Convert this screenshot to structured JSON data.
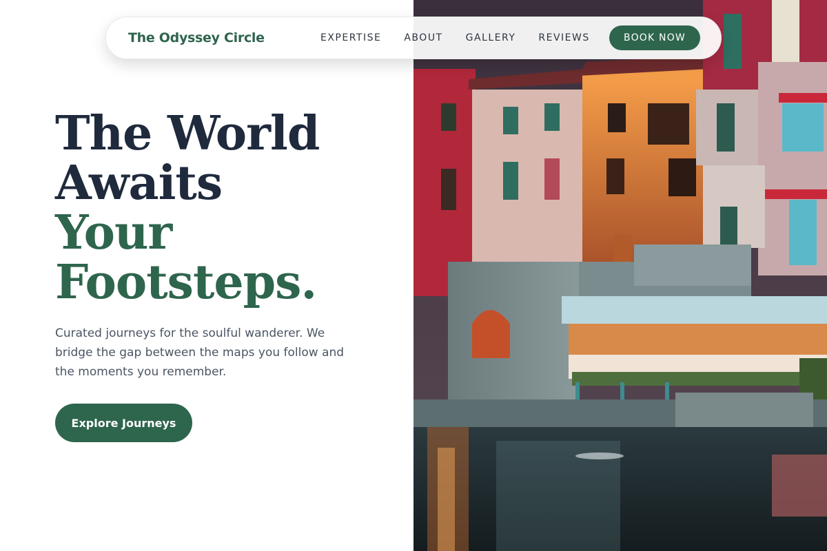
{
  "nav": {
    "brand": "The Odyssey Circle",
    "links": [
      "EXPERTISE",
      "ABOUT",
      "GALLERY",
      "REVIEWS"
    ],
    "cta": "BOOK NOW"
  },
  "hero": {
    "headline": {
      "line1": "The World",
      "line2": "Awaits",
      "line3": "Your",
      "line4": "Footsteps."
    },
    "subtext": "Curated journeys for the soulful wanderer. We bridge the gap between the maps you follow and the moments you remember.",
    "cta": "Explore Journeys",
    "image_label": "lakeside village at dusk photo"
  },
  "colors": {
    "brand_green": "#2e654d",
    "headline_dark": "#1f2a3d",
    "body_text": "#4a5563"
  }
}
